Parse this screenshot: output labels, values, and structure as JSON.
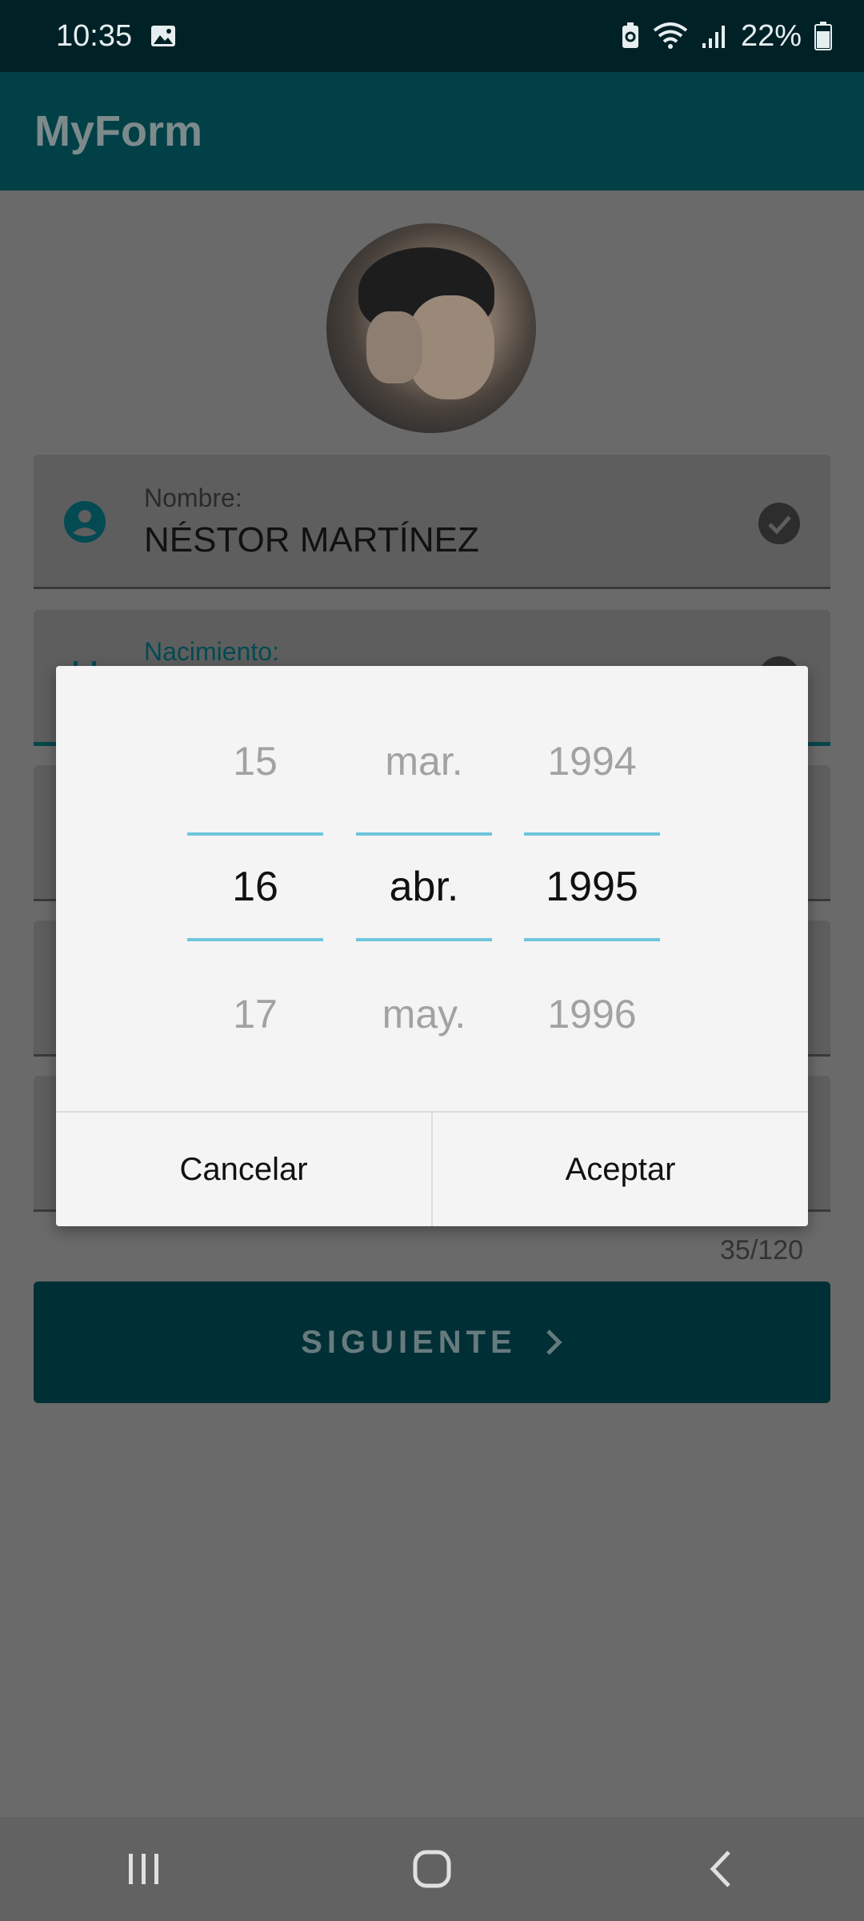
{
  "status": {
    "time": "10:35",
    "battery": "22%"
  },
  "appbar": {
    "title": "MyForm"
  },
  "form": {
    "name_label": "Nombre:",
    "name_value": "NÉSTOR MARTÍNEZ",
    "birth_label": "Nacimiento:",
    "counter": "35/120",
    "next_label": "SIGUIENTE"
  },
  "dialog": {
    "day": {
      "prev": "15",
      "selected": "16",
      "next": "17"
    },
    "month": {
      "prev": "mar.",
      "selected": "abr.",
      "next": "may."
    },
    "year": {
      "prev": "1994",
      "selected": "1995",
      "next": "1996"
    },
    "cancel_label": "Cancelar",
    "accept_label": "Aceptar"
  },
  "colors": {
    "primary": "#014046",
    "accent": "#70c5dd",
    "status_bar": "#002126"
  },
  "icons": [
    "image-icon",
    "battery-saver-icon",
    "wifi-icon",
    "signal-icon",
    "battery-icon",
    "person-icon",
    "check-icon",
    "calendar-icon",
    "chevron-right-icon",
    "recent-apps-icon",
    "home-icon",
    "back-icon"
  ]
}
